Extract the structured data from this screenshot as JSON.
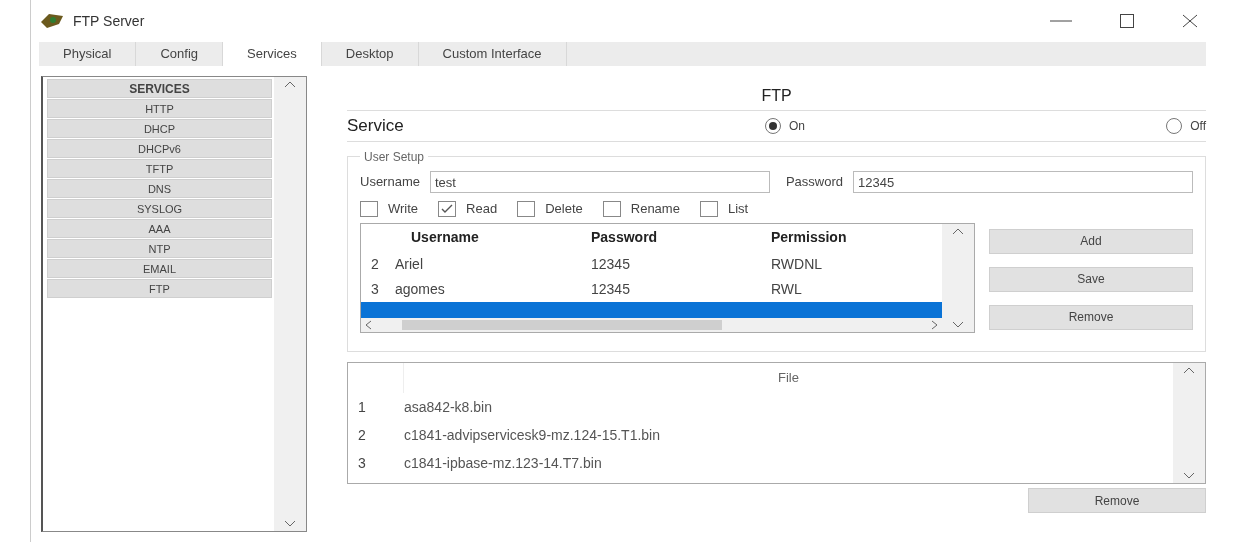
{
  "window": {
    "title": "FTP Server"
  },
  "tabs": [
    {
      "label": "Physical",
      "selected": false
    },
    {
      "label": "Config",
      "selected": false
    },
    {
      "label": "Services",
      "selected": true
    },
    {
      "label": "Desktop",
      "selected": false
    },
    {
      "label": "Custom Interface",
      "selected": false
    }
  ],
  "sidebar": {
    "header": "SERVICES",
    "items": [
      {
        "label": "HTTP",
        "selected": false
      },
      {
        "label": "DHCP",
        "selected": false
      },
      {
        "label": "DHCPv6",
        "selected": false
      },
      {
        "label": "TFTP",
        "selected": false
      },
      {
        "label": "DNS",
        "selected": false
      },
      {
        "label": "SYSLOG",
        "selected": false
      },
      {
        "label": "AAA",
        "selected": false
      },
      {
        "label": "NTP",
        "selected": false
      },
      {
        "label": "EMAIL",
        "selected": false
      },
      {
        "label": "FTP",
        "selected": false
      }
    ]
  },
  "panel": {
    "title": "FTP",
    "service_label": "Service",
    "radios": [
      {
        "label": "On",
        "selected": true
      },
      {
        "label": "Off",
        "selected": false
      }
    ],
    "user_setup": {
      "legend": "User Setup",
      "fields": [
        {
          "label": "Username",
          "value": "test"
        },
        {
          "label": "Password",
          "value": "12345"
        }
      ],
      "permissions": [
        {
          "label": "Write",
          "checked": false
        },
        {
          "label": "Read",
          "checked": true
        },
        {
          "label": "Delete",
          "checked": false
        },
        {
          "label": "Rename",
          "checked": false
        },
        {
          "label": "List",
          "checked": false
        }
      ],
      "table": {
        "columns": [
          "Username",
          "Password",
          "Permission"
        ],
        "rows": [
          {
            "index": "2",
            "cells": [
              "Ariel",
              "12345",
              "RWDNL"
            ],
            "selected": false
          },
          {
            "index": "3",
            "cells": [
              "agomes",
              "12345",
              "RWL"
            ],
            "selected": false
          },
          {
            "selected": true
          }
        ]
      },
      "buttons": [
        "Add",
        "Save",
        "Remove"
      ]
    },
    "files": {
      "column": "File",
      "rows": [
        {
          "index": "1",
          "name": "asa842-k8.bin"
        },
        {
          "index": "2",
          "name": "c1841-advipservicesk9-mz.124-15.T1.bin"
        },
        {
          "index": "3",
          "name": "c1841-ipbase-mz.123-14.T7.bin"
        }
      ]
    },
    "remove_button": "Remove"
  }
}
